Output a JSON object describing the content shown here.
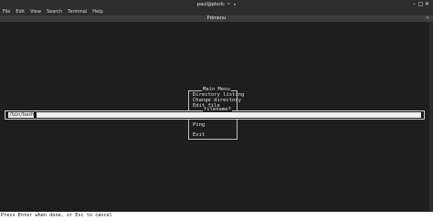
{
  "window": {
    "title": "paul@plock: ~",
    "dropdown_glyph": "▾",
    "controls": {
      "minimize": "–",
      "maximize": "□",
      "close": "✕"
    }
  },
  "menubar": {
    "items": [
      "File",
      "Edit",
      "View",
      "Search",
      "Terminal",
      "Help"
    ]
  },
  "tab": {
    "title": "Pdmenu",
    "close_glyph": "✕"
  },
  "main_menu": {
    "title": "Main Menu",
    "items": [
      "Directory listing",
      "Change directory",
      "Edit file",
      "Ping",
      "Exit"
    ]
  },
  "prompt": {
    "label": "filename?",
    "value": "/bin/bash"
  },
  "status": {
    "hint": "Press Enter when done, or Esc to cancel"
  },
  "colors": {
    "chrome": "#2d2d2d",
    "terminal_bg": "#1e1e1e",
    "terminal_fg": "#e0e0e0",
    "input_bg": "#f2f2f2"
  }
}
